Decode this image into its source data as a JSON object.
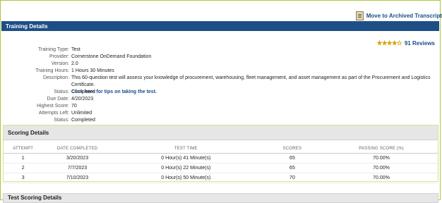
{
  "header": {
    "archive_label": "Move to Archived Transcript",
    "section_title": "Training Details"
  },
  "reviews": {
    "stars": "★★★★☆",
    "count_label": "91 Reviews",
    "rating_stars": 4
  },
  "details": {
    "training_type": {
      "label": "Training Type:",
      "value": "Test"
    },
    "provider": {
      "label": "Provider:",
      "value": "Cornerstone OnDemand Foundation"
    },
    "version": {
      "label": "Version:",
      "value": "2.0"
    },
    "training_hours": {
      "label": "Training Hours:",
      "value": "1 Hours 30 Minutes"
    },
    "description": {
      "label": "Description:",
      "value": "This 60-question test will assess your knowledge of procurement, warehousing, fleet management, and asset management as part of the Procurement and Logistics Certificate.",
      "link": "Click here for tips on taking the test."
    },
    "status": {
      "label": "Status:",
      "value": "Completed"
    },
    "due_date": {
      "label": "Due Date:",
      "value": "4/20/2023"
    },
    "highest_score": {
      "label": "Highest Score:",
      "value": "70"
    },
    "attempts_left": {
      "label": "Attempts Left:",
      "value": "Unlimited"
    },
    "status2": {
      "label": "Status:",
      "value": "Completed"
    }
  },
  "scoring": {
    "title": "Scoring Details",
    "columns": [
      "ATTEMPT",
      "DATE COMPLETED",
      "TEST TIME",
      "SCORES",
      "PASSING SCORE (%)"
    ],
    "rows": [
      [
        "1",
        "3/20/2023",
        "0 Hour(s) 41 Minute(s)",
        "65",
        "70.00%"
      ],
      [
        "2",
        "7/7/2023",
        "0 Hour(s) 22 Minute(s)",
        "65",
        "70.00%"
      ],
      [
        "3",
        "7/10/2023",
        "0 Hour(s) 50 Minute(s)",
        "70",
        "70.00%"
      ]
    ]
  },
  "test_scoring": {
    "title": "Test Scoring Details"
  }
}
